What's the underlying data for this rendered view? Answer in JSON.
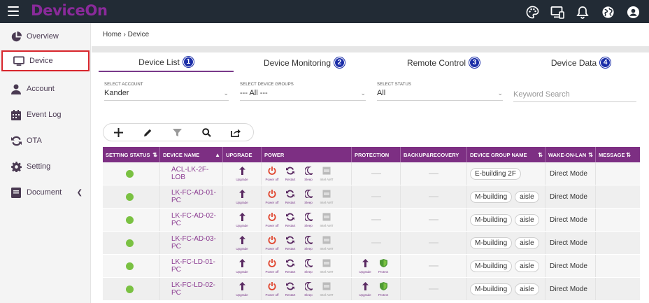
{
  "app": {
    "brand": "DeviceOn"
  },
  "topbar": {
    "icons": [
      "palette-icon",
      "monitor-icon",
      "bell-icon",
      "globe-icon",
      "user-icon"
    ]
  },
  "sidebar": {
    "items": [
      {
        "label": "Overview",
        "icon": "pie-chart-icon"
      },
      {
        "label": "Device",
        "icon": "monitor-icon"
      },
      {
        "label": "Account",
        "icon": "user-icon"
      },
      {
        "label": "Event Log",
        "icon": "calendar-icon"
      },
      {
        "label": "OTA",
        "icon": "sync-icon"
      },
      {
        "label": "Setting",
        "icon": "gear-icon"
      },
      {
        "label": "Document",
        "icon": "book-icon"
      }
    ]
  },
  "breadcrumb": {
    "home": "Home",
    "sep": "›",
    "current": "Device"
  },
  "tabs": [
    {
      "label": "Device List",
      "num": "1"
    },
    {
      "label": "Device Monitoring",
      "num": "2"
    },
    {
      "label": "Remote Control",
      "num": "3"
    },
    {
      "label": "Device Data",
      "num": "4"
    }
  ],
  "filters": {
    "account": {
      "label": "SELECT ACCOUNT",
      "value": "Kander"
    },
    "groups": {
      "label": "SELECT DEVICE GROUPS",
      "value": "--- All ---"
    },
    "status": {
      "label": "SELECT STATUS",
      "value": "All"
    },
    "keyword_placeholder": "Keyword Search"
  },
  "table": {
    "headers": [
      "SETTING STATUS",
      "DEVICE NAME",
      "UPGRADE",
      "POWER",
      "PROTECTION",
      "BACKUP&RECOVERY",
      "DEVICE GROUP NAME",
      "WAKE-ON-LAN",
      "MESSAGE"
    ],
    "sort_glyph": "⇅",
    "asc_glyph": "▲",
    "action_labels": {
      "upgrade": "Upgrade",
      "power_off": "Power off",
      "restart": "Restart",
      "sleep": "Sleep",
      "amt": "Intel AMT",
      "protect": "Protect"
    },
    "rows": [
      {
        "name": "ACL-LK-2F-LOB",
        "groups": [
          "E-building 2F"
        ],
        "wol": "Direct Mode",
        "protection": false
      },
      {
        "name": "LK-FC-AD-01-PC",
        "groups": [
          "M-building",
          "aisle"
        ],
        "wol": "Direct Mode",
        "protection": false
      },
      {
        "name": "LK-FC-AD-02-PC",
        "groups": [
          "M-building",
          "aisle"
        ],
        "wol": "Direct Mode",
        "protection": false
      },
      {
        "name": "LK-FC-AD-03-PC",
        "groups": [
          "M-building",
          "aisle"
        ],
        "wol": "Direct Mode",
        "protection": false
      },
      {
        "name": "LK-FC-LD-01-PC",
        "groups": [
          "M-building",
          "aisle"
        ],
        "wol": "Direct Mode",
        "protection": true
      },
      {
        "name": "LK-FC-LD-02-PC",
        "groups": [
          "M-building",
          "aisle"
        ],
        "wol": "Direct Mode",
        "protection": true
      }
    ]
  },
  "colors": {
    "brand": "#8a2a9a",
    "header": "#7d2f83",
    "status_ok": "#7ac142",
    "badge": "#1b2ea8",
    "power": "#e0452e"
  }
}
